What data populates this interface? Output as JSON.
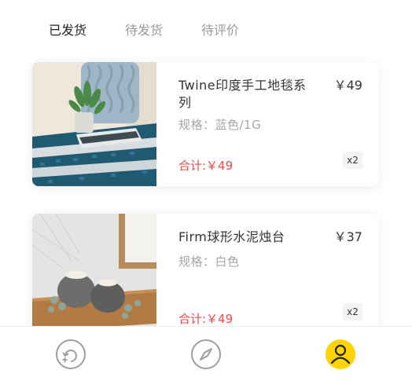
{
  "tabs": [
    {
      "label": "已发货",
      "active": true
    },
    {
      "label": "待发货",
      "active": false
    },
    {
      "label": "待评价",
      "active": false
    }
  ],
  "orders": [
    {
      "name": "Twine印度手工地毯系列",
      "price": "￥49",
      "spec": "规格：蓝色/1G",
      "total": "合计:￥49",
      "qty": "x2",
      "image": "woven-rug-photo"
    },
    {
      "name": "Firm球形水泥烛台",
      "price": "￥37",
      "spec": "规格：白色",
      "total": "合计:￥49",
      "qty": "x2",
      "image": "cement-candle-holder-photo"
    }
  ],
  "tabbar": {
    "items": [
      {
        "icon": "refresh-add-icon",
        "active": false
      },
      {
        "icon": "compass-icon",
        "active": false
      },
      {
        "icon": "user-icon",
        "active": true
      }
    ]
  },
  "colors": {
    "accent": "#FFD400",
    "price_red": "#F04A4A",
    "text_dark": "#333333",
    "text_gray": "#A6A6A6",
    "icon_gray": "#9E9E9E"
  }
}
